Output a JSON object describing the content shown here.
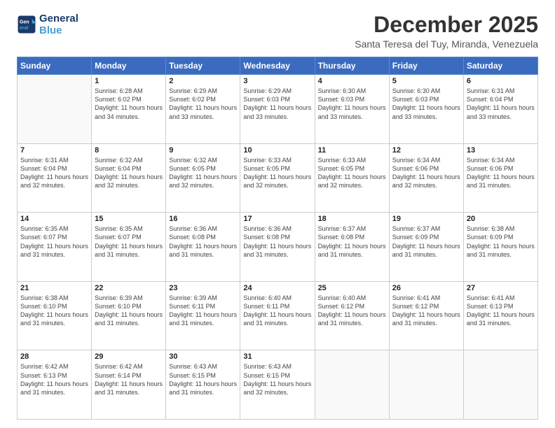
{
  "logo": {
    "line1": "General",
    "line2": "Blue"
  },
  "header": {
    "month": "December 2025",
    "location": "Santa Teresa del Tuy, Miranda, Venezuela"
  },
  "days_of_week": [
    "Sunday",
    "Monday",
    "Tuesday",
    "Wednesday",
    "Thursday",
    "Friday",
    "Saturday"
  ],
  "weeks": [
    [
      {
        "day": "",
        "empty": true
      },
      {
        "day": "1",
        "sunrise": "Sunrise: 6:28 AM",
        "sunset": "Sunset: 6:02 PM",
        "daylight": "Daylight: 11 hours and 34 minutes."
      },
      {
        "day": "2",
        "sunrise": "Sunrise: 6:29 AM",
        "sunset": "Sunset: 6:02 PM",
        "daylight": "Daylight: 11 hours and 33 minutes."
      },
      {
        "day": "3",
        "sunrise": "Sunrise: 6:29 AM",
        "sunset": "Sunset: 6:03 PM",
        "daylight": "Daylight: 11 hours and 33 minutes."
      },
      {
        "day": "4",
        "sunrise": "Sunrise: 6:30 AM",
        "sunset": "Sunset: 6:03 PM",
        "daylight": "Daylight: 11 hours and 33 minutes."
      },
      {
        "day": "5",
        "sunrise": "Sunrise: 6:30 AM",
        "sunset": "Sunset: 6:03 PM",
        "daylight": "Daylight: 11 hours and 33 minutes."
      },
      {
        "day": "6",
        "sunrise": "Sunrise: 6:31 AM",
        "sunset": "Sunset: 6:04 PM",
        "daylight": "Daylight: 11 hours and 33 minutes."
      }
    ],
    [
      {
        "day": "7",
        "sunrise": "Sunrise: 6:31 AM",
        "sunset": "Sunset: 6:04 PM",
        "daylight": "Daylight: 11 hours and 32 minutes."
      },
      {
        "day": "8",
        "sunrise": "Sunrise: 6:32 AM",
        "sunset": "Sunset: 6:04 PM",
        "daylight": "Daylight: 11 hours and 32 minutes."
      },
      {
        "day": "9",
        "sunrise": "Sunrise: 6:32 AM",
        "sunset": "Sunset: 6:05 PM",
        "daylight": "Daylight: 11 hours and 32 minutes."
      },
      {
        "day": "10",
        "sunrise": "Sunrise: 6:33 AM",
        "sunset": "Sunset: 6:05 PM",
        "daylight": "Daylight: 11 hours and 32 minutes."
      },
      {
        "day": "11",
        "sunrise": "Sunrise: 6:33 AM",
        "sunset": "Sunset: 6:05 PM",
        "daylight": "Daylight: 11 hours and 32 minutes."
      },
      {
        "day": "12",
        "sunrise": "Sunrise: 6:34 AM",
        "sunset": "Sunset: 6:06 PM",
        "daylight": "Daylight: 11 hours and 32 minutes."
      },
      {
        "day": "13",
        "sunrise": "Sunrise: 6:34 AM",
        "sunset": "Sunset: 6:06 PM",
        "daylight": "Daylight: 11 hours and 31 minutes."
      }
    ],
    [
      {
        "day": "14",
        "sunrise": "Sunrise: 6:35 AM",
        "sunset": "Sunset: 6:07 PM",
        "daylight": "Daylight: 11 hours and 31 minutes."
      },
      {
        "day": "15",
        "sunrise": "Sunrise: 6:35 AM",
        "sunset": "Sunset: 6:07 PM",
        "daylight": "Daylight: 11 hours and 31 minutes."
      },
      {
        "day": "16",
        "sunrise": "Sunrise: 6:36 AM",
        "sunset": "Sunset: 6:08 PM",
        "daylight": "Daylight: 11 hours and 31 minutes."
      },
      {
        "day": "17",
        "sunrise": "Sunrise: 6:36 AM",
        "sunset": "Sunset: 6:08 PM",
        "daylight": "Daylight: 11 hours and 31 minutes."
      },
      {
        "day": "18",
        "sunrise": "Sunrise: 6:37 AM",
        "sunset": "Sunset: 6:08 PM",
        "daylight": "Daylight: 11 hours and 31 minutes."
      },
      {
        "day": "19",
        "sunrise": "Sunrise: 6:37 AM",
        "sunset": "Sunset: 6:09 PM",
        "daylight": "Daylight: 11 hours and 31 minutes."
      },
      {
        "day": "20",
        "sunrise": "Sunrise: 6:38 AM",
        "sunset": "Sunset: 6:09 PM",
        "daylight": "Daylight: 11 hours and 31 minutes."
      }
    ],
    [
      {
        "day": "21",
        "sunrise": "Sunrise: 6:38 AM",
        "sunset": "Sunset: 6:10 PM",
        "daylight": "Daylight: 11 hours and 31 minutes."
      },
      {
        "day": "22",
        "sunrise": "Sunrise: 6:39 AM",
        "sunset": "Sunset: 6:10 PM",
        "daylight": "Daylight: 11 hours and 31 minutes."
      },
      {
        "day": "23",
        "sunrise": "Sunrise: 6:39 AM",
        "sunset": "Sunset: 6:11 PM",
        "daylight": "Daylight: 11 hours and 31 minutes."
      },
      {
        "day": "24",
        "sunrise": "Sunrise: 6:40 AM",
        "sunset": "Sunset: 6:11 PM",
        "daylight": "Daylight: 11 hours and 31 minutes."
      },
      {
        "day": "25",
        "sunrise": "Sunrise: 6:40 AM",
        "sunset": "Sunset: 6:12 PM",
        "daylight": "Daylight: 11 hours and 31 minutes."
      },
      {
        "day": "26",
        "sunrise": "Sunrise: 6:41 AM",
        "sunset": "Sunset: 6:12 PM",
        "daylight": "Daylight: 11 hours and 31 minutes."
      },
      {
        "day": "27",
        "sunrise": "Sunrise: 6:41 AM",
        "sunset": "Sunset: 6:13 PM",
        "daylight": "Daylight: 11 hours and 31 minutes."
      }
    ],
    [
      {
        "day": "28",
        "sunrise": "Sunrise: 6:42 AM",
        "sunset": "Sunset: 6:13 PM",
        "daylight": "Daylight: 11 hours and 31 minutes."
      },
      {
        "day": "29",
        "sunrise": "Sunrise: 6:42 AM",
        "sunset": "Sunset: 6:14 PM",
        "daylight": "Daylight: 11 hours and 31 minutes."
      },
      {
        "day": "30",
        "sunrise": "Sunrise: 6:43 AM",
        "sunset": "Sunset: 6:15 PM",
        "daylight": "Daylight: 11 hours and 31 minutes."
      },
      {
        "day": "31",
        "sunrise": "Sunrise: 6:43 AM",
        "sunset": "Sunset: 6:15 PM",
        "daylight": "Daylight: 11 hours and 32 minutes."
      },
      {
        "day": "",
        "empty": true
      },
      {
        "day": "",
        "empty": true
      },
      {
        "day": "",
        "empty": true
      }
    ]
  ]
}
